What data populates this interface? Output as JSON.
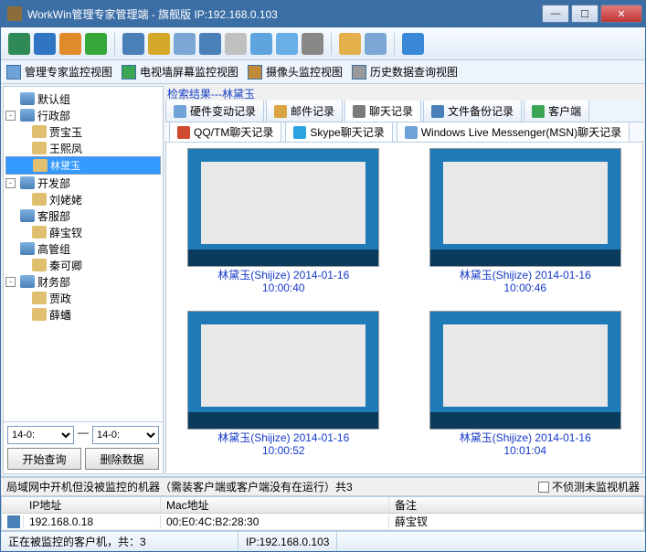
{
  "title": "WorkWin管理专家管理端 - 旗舰版 IP:192.168.0.103",
  "views": {
    "v1": "管理专家监控视图",
    "v2": "电视墙屏幕监控视图",
    "v3": "摄像头监控视图",
    "v4": "历史数据查询视图"
  },
  "search_result_label": "检索结果---林黛玉",
  "tree": {
    "g0": "默认组",
    "g1": "行政部",
    "g1u1": "贾宝玉",
    "g1u2": "王熙凤",
    "g1u3": "林黛玉",
    "g2": "开发部",
    "g2u1": "刘姥姥",
    "g3": "客服部",
    "g3u1": "薛宝钗",
    "g4": "高管组",
    "g4u1": "秦可卿",
    "g5": "财务部",
    "g5u1": "贾政",
    "g5u2": "薛蟠"
  },
  "time_from": "14-0:",
  "time_to": "14-0:",
  "btn_query": "开始查询",
  "btn_delete": "删除数据",
  "tabs1": {
    "t1": "硬件变动记录",
    "t2": "邮件记录",
    "t3": "聊天记录",
    "t4": "文件备份记录",
    "t5": "客户端"
  },
  "tabs2": {
    "s1": "QQ/TM聊天记录",
    "s2": "Skype聊天记录",
    "s3": "Windows Live Messenger(MSN)聊天记录"
  },
  "thumbs": [
    {
      "name": "林黛玉(Shijize) 2014-01-16",
      "time": "10:00:40"
    },
    {
      "name": "林黛玉(Shijize) 2014-01-16",
      "time": "10:00:46"
    },
    {
      "name": "林黛玉(Shijize) 2014-01-16",
      "time": "10:00:52"
    },
    {
      "name": "林黛玉(Shijize) 2014-01-16",
      "time": "10:01:04"
    }
  ],
  "bottom_header": "局域网中开机但没被监控的机器（需装客户端或客户端没有在运行）共3",
  "chk_label": "不侦测未监视机器",
  "cols": {
    "ip": "IP地址",
    "mac": "Mac地址",
    "remark": "备注"
  },
  "row": {
    "ip": "192.168.0.18",
    "mac": "00:E0:4C:B2:28:30",
    "remark": "薛宝钗"
  },
  "status1": "正在被监控的客户机，共：3",
  "status2": "IP:192.168.0.103"
}
